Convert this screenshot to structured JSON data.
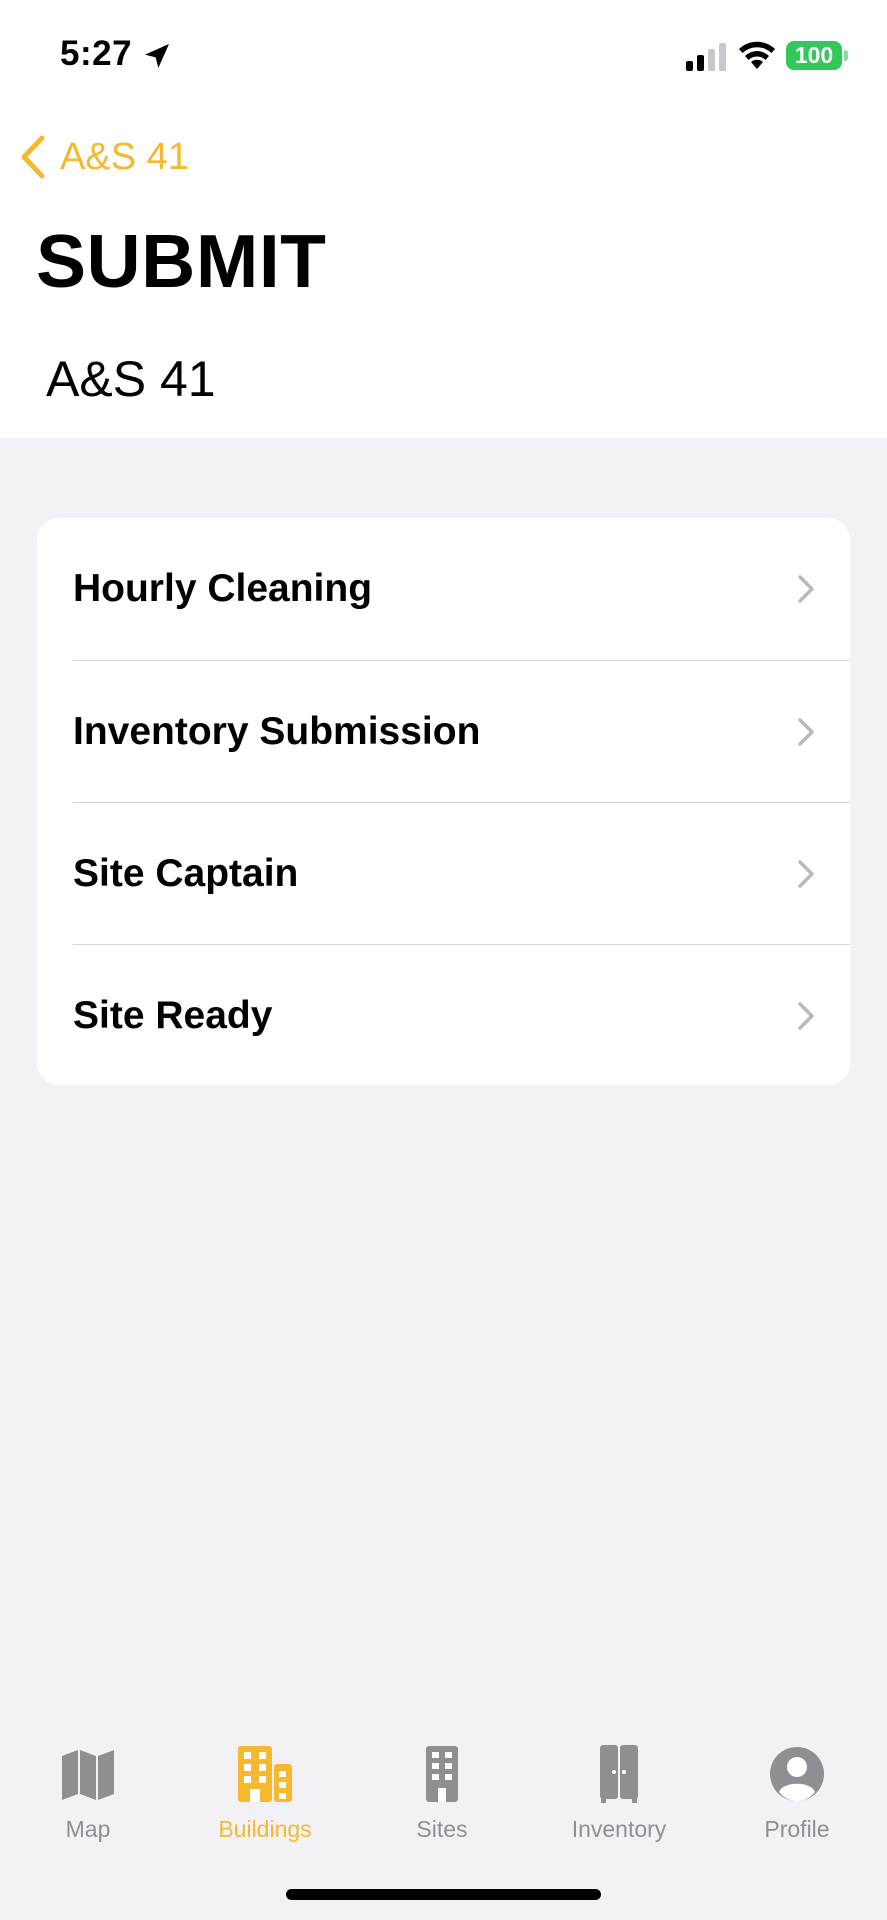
{
  "status_bar": {
    "time": "5:27",
    "battery": "100"
  },
  "nav": {
    "back_label": "A&S 41",
    "title": "SUBMIT",
    "subtitle": "A&S 41"
  },
  "list": {
    "items": [
      {
        "label": "Hourly Cleaning"
      },
      {
        "label": "Inventory Submission"
      },
      {
        "label": "Site Captain"
      },
      {
        "label": "Site Ready"
      }
    ]
  },
  "tab_bar": {
    "tabs": [
      {
        "label": "Map",
        "icon": "map-icon",
        "active": false
      },
      {
        "label": "Buildings",
        "icon": "buildings-icon",
        "active": true
      },
      {
        "label": "Sites",
        "icon": "building-icon",
        "active": false
      },
      {
        "label": "Inventory",
        "icon": "cabinet-icon",
        "active": false
      },
      {
        "label": "Profile",
        "icon": "profile-icon",
        "active": false
      }
    ]
  },
  "colors": {
    "accent": "#f5b82e",
    "inactive": "#8e8e93",
    "background": "#f1f1f6",
    "battery": "#34c759"
  }
}
